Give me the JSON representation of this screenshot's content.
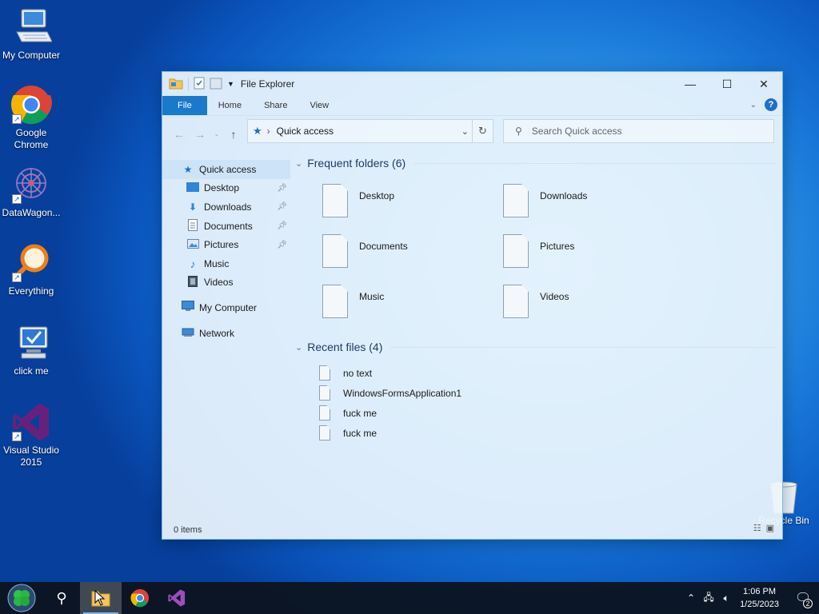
{
  "desktop": {
    "icons": [
      {
        "label": "My Computer",
        "icon": "computer-icon"
      },
      {
        "label": "Google Chrome",
        "icon": "chrome-icon"
      },
      {
        "label": "DataWagon...",
        "icon": "datawagon-icon"
      },
      {
        "label": "Everything",
        "icon": "everything-icon"
      },
      {
        "label": "click me",
        "icon": "click-me-icon"
      },
      {
        "label": "Visual Studio 2015",
        "icon": "visual-studio-icon"
      }
    ],
    "recycle_bin": "Recycle Bin"
  },
  "explorer": {
    "title": "File Explorer",
    "controls": {
      "minimize": "—",
      "maximize": "☐",
      "close": "✕"
    },
    "ribbon_tabs": [
      "File",
      "Home",
      "Share",
      "View"
    ],
    "address": {
      "location": "Quick access"
    },
    "search": {
      "placeholder": "Search Quick access"
    },
    "sidebar": {
      "quick_access": "Quick access",
      "items": [
        {
          "label": "Desktop",
          "pinned": true
        },
        {
          "label": "Downloads",
          "pinned": true
        },
        {
          "label": "Documents",
          "pinned": true
        },
        {
          "label": "Pictures",
          "pinned": true
        },
        {
          "label": "Music",
          "pinned": false
        },
        {
          "label": "Videos",
          "pinned": false
        }
      ],
      "my_computer": "My Computer",
      "network": "Network"
    },
    "frequent": {
      "header": "Frequent folders (6)",
      "folders": [
        "Desktop",
        "Downloads",
        "Documents",
        "Pictures",
        "Music",
        "Videos"
      ]
    },
    "recent": {
      "header": "Recent files (4)",
      "files": [
        "no text",
        "WindowsFormsApplication1",
        "fuck me",
        "fuck me"
      ]
    },
    "status": "0 items"
  },
  "taskbar": {
    "time": "1:06 PM",
    "date": "1/25/2023",
    "notifications": "2"
  },
  "colors": {
    "accent": "#1979ca",
    "taskbar": "#0c121c"
  }
}
